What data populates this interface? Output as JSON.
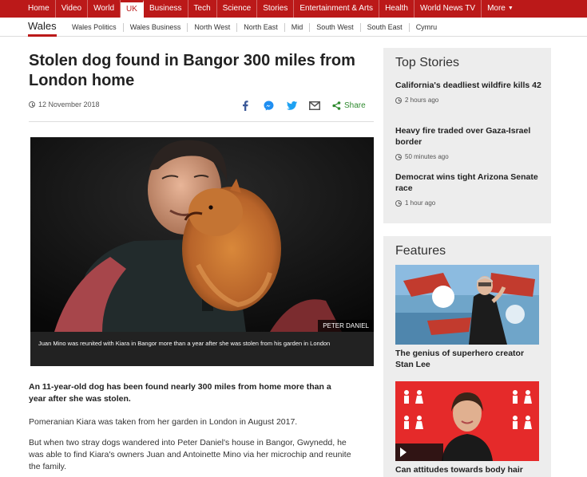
{
  "nav": {
    "items": [
      "Home",
      "Video",
      "World",
      "UK",
      "Business",
      "Tech",
      "Science",
      "Stories",
      "Entertainment & Arts",
      "Health",
      "World News TV",
      "More"
    ]
  },
  "subnav": {
    "home": "Wales",
    "links": [
      "Wales Politics",
      "Wales Business",
      "North West",
      "North East",
      "Mid",
      "South West",
      "South East",
      "Cymru"
    ]
  },
  "article": {
    "headline": "Stolen dog found in Bangor 300 miles from London home",
    "date": "12 November 2018",
    "share_label": "Share",
    "image_credit": "PETER DANIEL",
    "caption": "Juan Mino was reunited with Kiara in Bangor more than a year after she was stolen from his garden in London",
    "intro": "An 11-year-old dog has been found nearly 300 miles from home more than a year after she was stolen.",
    "paragraphs": [
      "Pomeranian Kiara was taken from her garden in London in August 2017.",
      "But when two stray dogs wandered into Peter Daniel's house in Bangor, Gwynedd, he was able to find Kiara's owners Juan and Antoinette Mino via her microchip and reunite the family."
    ]
  },
  "sidebar": {
    "top_stories_title": "Top Stories",
    "top_stories": [
      {
        "title": "California's deadliest wildfire kills 42",
        "time": "2 hours ago"
      },
      {
        "title": "Heavy fire traded over Gaza-Israel border",
        "time": "50 minutes ago"
      },
      {
        "title": "Democrat wins tight Arizona Senate race",
        "time": "1 hour ago"
      }
    ],
    "features_title": "Features",
    "features": [
      {
        "title": "The genius of superhero creator Stan Lee"
      },
      {
        "title": "Can attitudes towards body hair"
      }
    ]
  },
  "colors": {
    "brand_red": "#bb1919",
    "share_green": "#2e8a2e",
    "panel_bg": "#ededed"
  }
}
